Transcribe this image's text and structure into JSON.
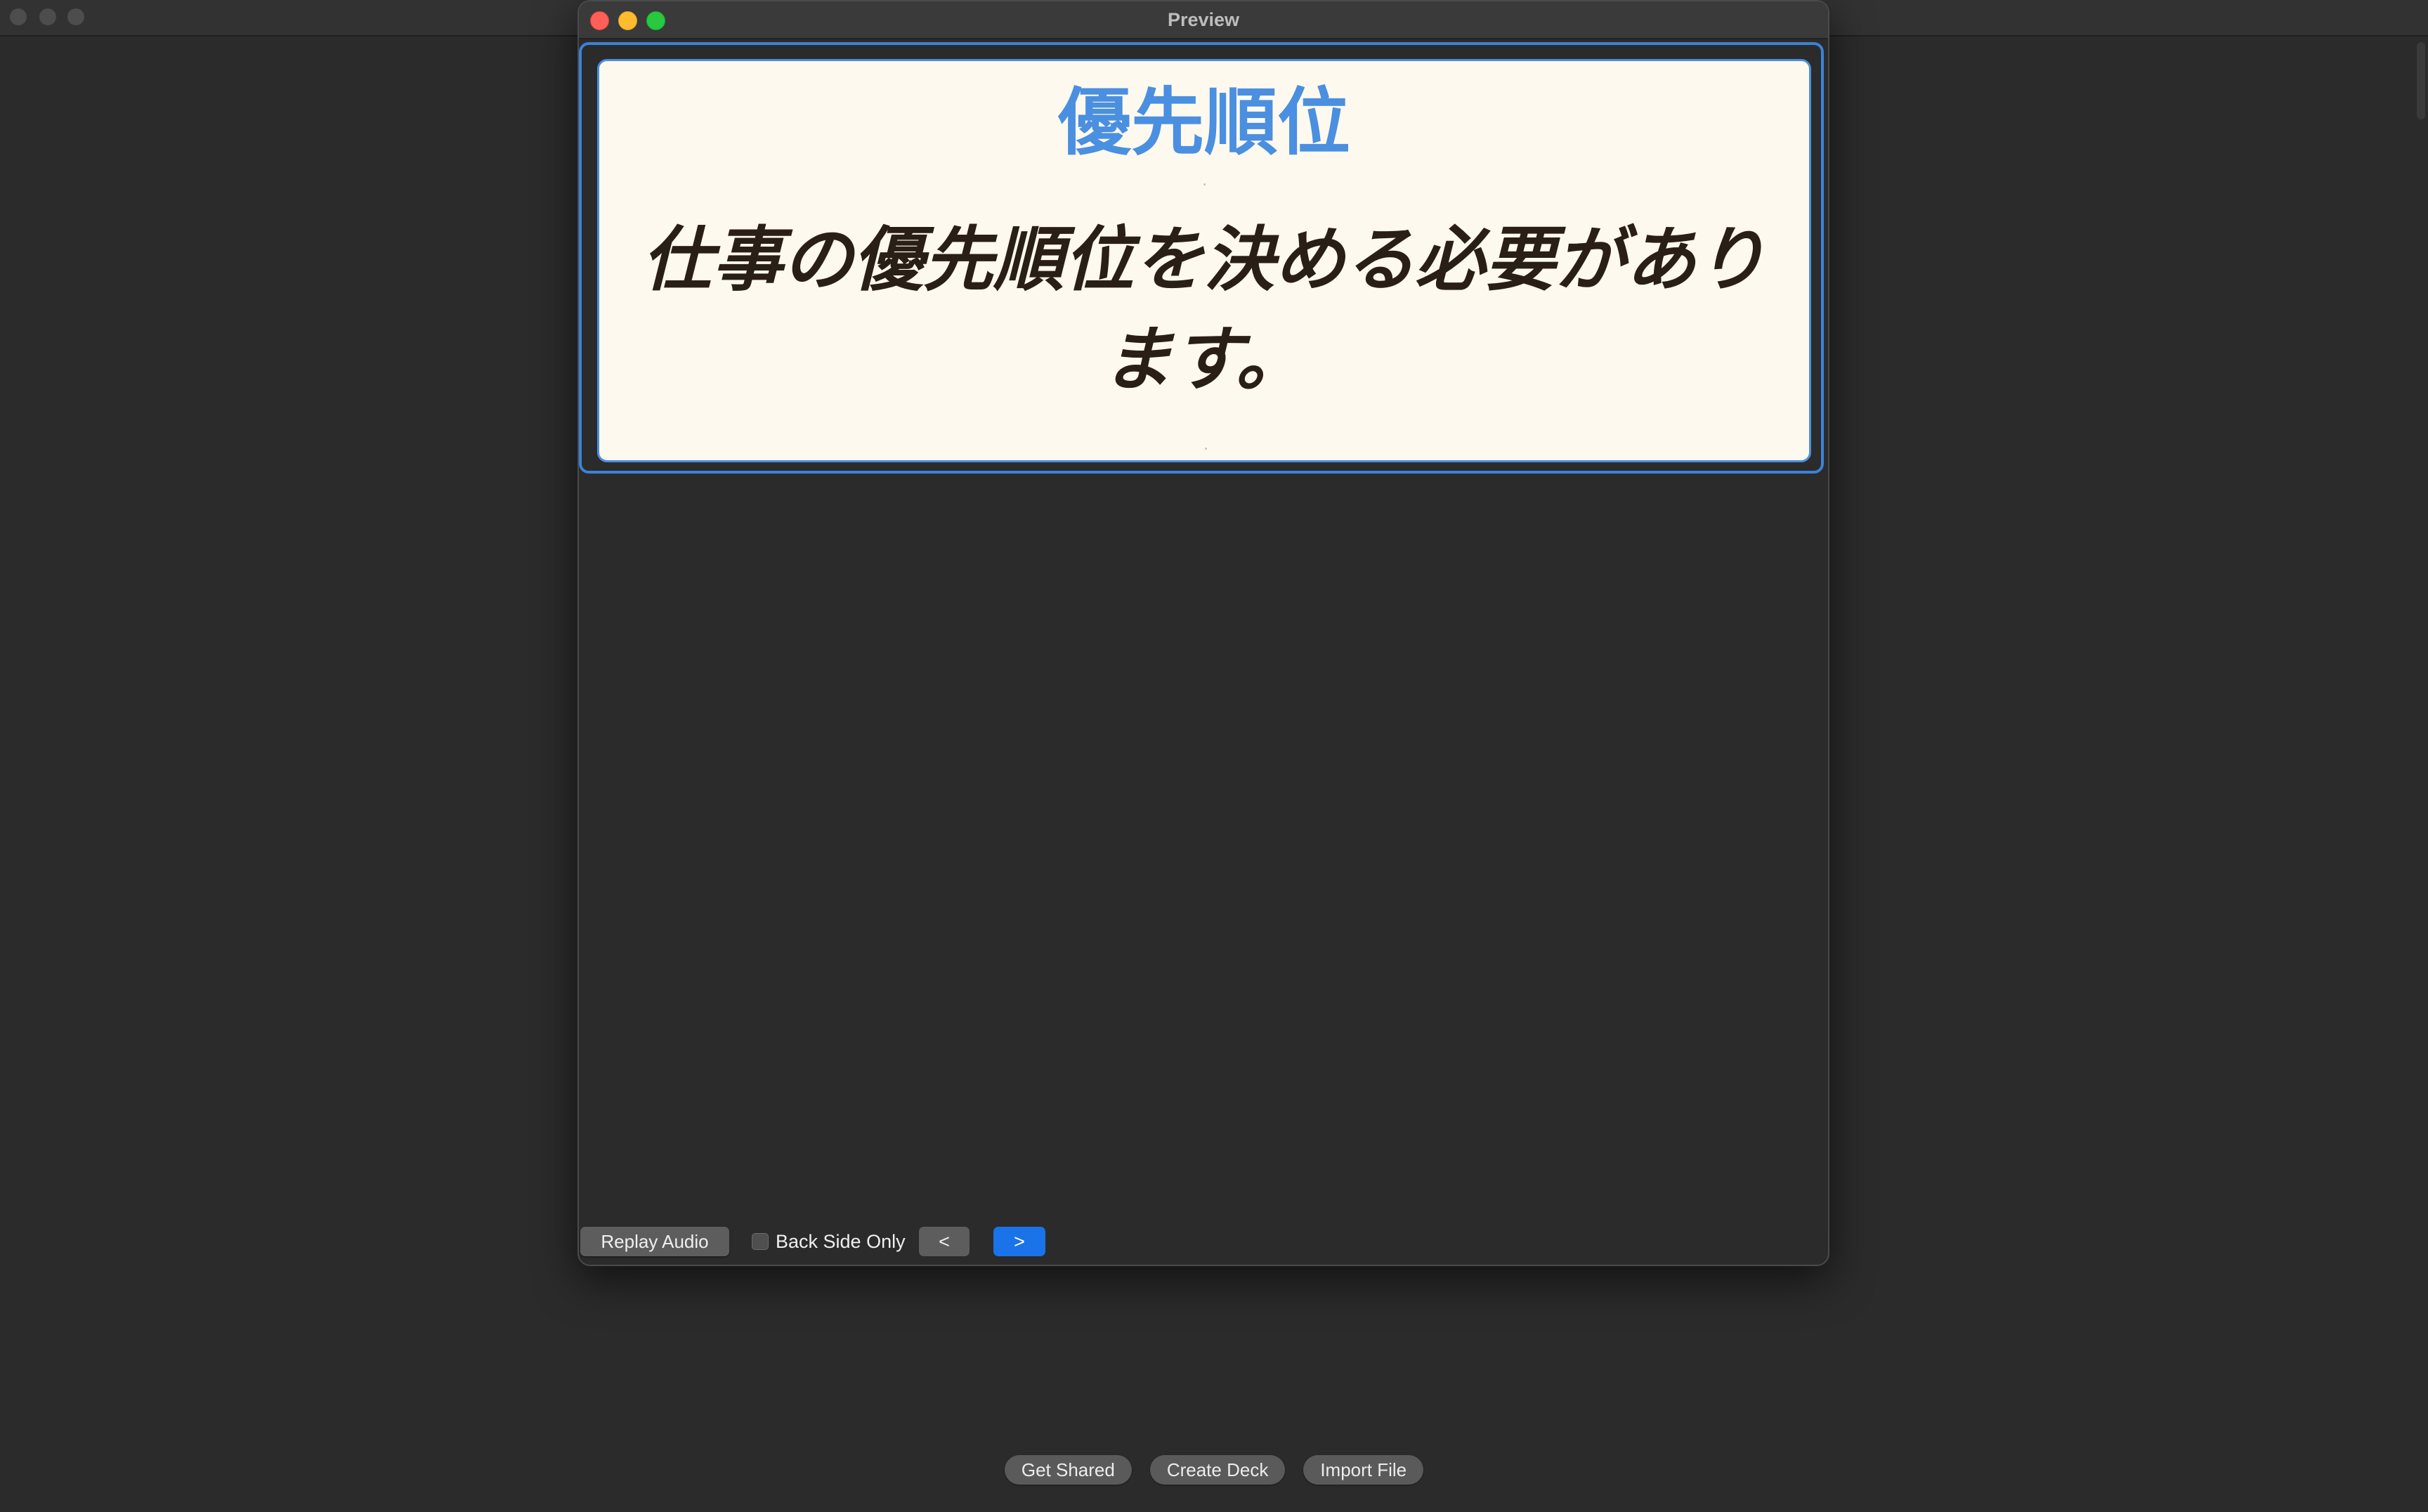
{
  "background_window": {
    "bottom_buttons": [
      {
        "label": "Get Shared"
      },
      {
        "label": "Create Deck"
      },
      {
        "label": "Import File"
      }
    ]
  },
  "preview_window": {
    "title": "Preview",
    "card": {
      "word": "優先順位",
      "sentence": "仕事の優先順位を決める必要があります。"
    },
    "controls": {
      "replay_label": "Replay Audio",
      "back_side_only_label": "Back Side Only",
      "back_side_only_checked": false,
      "prev_label": "<",
      "next_label": ">"
    }
  },
  "colors": {
    "accent": "#1a73e8",
    "card_word": "#4a8fe0",
    "card_background": "#fdf9ee",
    "focus_ring": "#3b82d6"
  }
}
